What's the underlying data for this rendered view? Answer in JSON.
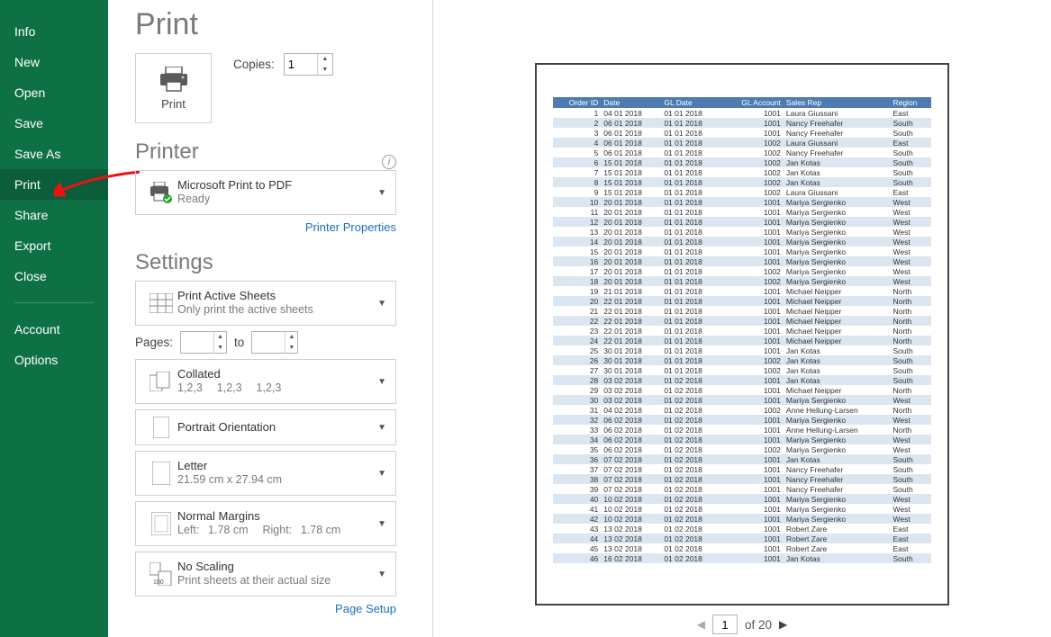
{
  "sidebar": {
    "items": [
      {
        "label": "Info"
      },
      {
        "label": "New"
      },
      {
        "label": "Open"
      },
      {
        "label": "Save"
      },
      {
        "label": "Save As"
      },
      {
        "label": "Print",
        "active": true
      },
      {
        "label": "Share"
      },
      {
        "label": "Export"
      },
      {
        "label": "Close"
      }
    ],
    "lower_items": [
      {
        "label": "Account"
      },
      {
        "label": "Options"
      }
    ]
  },
  "title": "Print",
  "print_button_label": "Print",
  "copies_label": "Copies:",
  "copies_value": "1",
  "printer_section": "Printer",
  "printer_name": "Microsoft Print to PDF",
  "printer_status": "Ready",
  "printer_properties": "Printer Properties",
  "settings_section": "Settings",
  "dd_active_sheets": {
    "title": "Print Active Sheets",
    "sub": "Only print the active sheets"
  },
  "pages_label": "Pages:",
  "pages_to": "to",
  "dd_collated": {
    "title": "Collated",
    "sub": "1,2,3  1,2,3  1,2,3"
  },
  "dd_orientation": {
    "title": "Portrait Orientation"
  },
  "dd_papersize": {
    "title": "Letter",
    "sub": "21.59 cm x 27.94 cm"
  },
  "dd_margins": {
    "title": "Normal Margins",
    "sub": "Left:  1.78 cm  Right:  1.78 cm"
  },
  "dd_scaling": {
    "title": "No Scaling",
    "sub": "Print sheets at their actual size"
  },
  "page_setup": "Page Setup",
  "pager": {
    "current": "1",
    "total": "of 20"
  },
  "preview_headers": [
    "Order ID",
    "Date",
    "GL Date",
    "GL Account",
    "Sales Rep",
    "Region"
  ],
  "preview_rows": [
    [
      "1",
      "04 01 2018",
      "01 01 2018",
      "1001",
      "Laura Giussani",
      "East"
    ],
    [
      "2",
      "06 01 2018",
      "01 01 2018",
      "1001",
      "Nancy Freehafer",
      "South"
    ],
    [
      "3",
      "06 01 2018",
      "01 01 2018",
      "1001",
      "Nancy Freehafer",
      "South"
    ],
    [
      "4",
      "06 01 2018",
      "01 01 2018",
      "1002",
      "Laura Giussani",
      "East"
    ],
    [
      "5",
      "06 01 2018",
      "01 01 2018",
      "1002",
      "Nancy Freehafer",
      "South"
    ],
    [
      "6",
      "15 01 2018",
      "01 01 2018",
      "1002",
      "Jan Kotas",
      "South"
    ],
    [
      "7",
      "15 01 2018",
      "01 01 2018",
      "1002",
      "Jan Kotas",
      "South"
    ],
    [
      "8",
      "15 01 2018",
      "01 01 2018",
      "1002",
      "Jan Kotas",
      "South"
    ],
    [
      "9",
      "15 01 2018",
      "01 01 2018",
      "1002",
      "Laura Giussani",
      "East"
    ],
    [
      "10",
      "20 01 2018",
      "01 01 2018",
      "1001",
      "Mariya Sergienko",
      "West"
    ],
    [
      "11",
      "20 01 2018",
      "01 01 2018",
      "1001",
      "Mariya Sergienko",
      "West"
    ],
    [
      "12",
      "20 01 2018",
      "01 01 2018",
      "1001",
      "Mariya Sergienko",
      "West"
    ],
    [
      "13",
      "20 01 2018",
      "01 01 2018",
      "1001",
      "Mariya Sergienko",
      "West"
    ],
    [
      "14",
      "20 01 2018",
      "01 01 2018",
      "1001",
      "Mariya Sergienko",
      "West"
    ],
    [
      "15",
      "20 01 2018",
      "01 01 2018",
      "1001",
      "Mariya Sergienko",
      "West"
    ],
    [
      "16",
      "20 01 2018",
      "01 01 2018",
      "1001",
      "Mariya Sergienko",
      "West"
    ],
    [
      "17",
      "20 01 2018",
      "01 01 2018",
      "1002",
      "Mariya Sergienko",
      "West"
    ],
    [
      "18",
      "20 01 2018",
      "01 01 2018",
      "1002",
      "Mariya Sergienko",
      "West"
    ],
    [
      "19",
      "21 01 2018",
      "01 01 2018",
      "1001",
      "Michael Neipper",
      "North"
    ],
    [
      "20",
      "22 01 2018",
      "01 01 2018",
      "1001",
      "Michael Neipper",
      "North"
    ],
    [
      "21",
      "22 01 2018",
      "01 01 2018",
      "1001",
      "Michael Neipper",
      "North"
    ],
    [
      "22",
      "22 01 2018",
      "01 01 2018",
      "1001",
      "Michael Neipper",
      "North"
    ],
    [
      "23",
      "22 01 2018",
      "01 01 2018",
      "1001",
      "Michael Neipper",
      "North"
    ],
    [
      "24",
      "22 01 2018",
      "01 01 2018",
      "1001",
      "Michael Neipper",
      "North"
    ],
    [
      "25",
      "30 01 2018",
      "01 01 2018",
      "1001",
      "Jan Kotas",
      "South"
    ],
    [
      "26",
      "30 01 2018",
      "01 01 2018",
      "1002",
      "Jan Kotas",
      "South"
    ],
    [
      "27",
      "30 01 2018",
      "01 01 2018",
      "1002",
      "Jan Kotas",
      "South"
    ],
    [
      "28",
      "03 02 2018",
      "01 02 2018",
      "1001",
      "Jan Kotas",
      "South"
    ],
    [
      "29",
      "03 02 2018",
      "01 02 2018",
      "1001",
      "Michael Neipper",
      "North"
    ],
    [
      "30",
      "03 02 2018",
      "01 02 2018",
      "1001",
      "Mariya Sergienko",
      "West"
    ],
    [
      "31",
      "04 02 2018",
      "01 02 2018",
      "1002",
      "Anne Hellung-Larsen",
      "North"
    ],
    [
      "32",
      "06 02 2018",
      "01 02 2018",
      "1001",
      "Mariya Sergienko",
      "West"
    ],
    [
      "33",
      "06 02 2018",
      "01 02 2018",
      "1001",
      "Anne Hellung-Larsen",
      "North"
    ],
    [
      "34",
      "06 02 2018",
      "01 02 2018",
      "1001",
      "Mariya Sergienko",
      "West"
    ],
    [
      "35",
      "06 02 2018",
      "01 02 2018",
      "1002",
      "Mariya Sergienko",
      "West"
    ],
    [
      "36",
      "07 02 2018",
      "01 02 2018",
      "1001",
      "Jan Kotas",
      "South"
    ],
    [
      "37",
      "07 02 2018",
      "01 02 2018",
      "1001",
      "Nancy Freehafer",
      "South"
    ],
    [
      "38",
      "07 02 2018",
      "01 02 2018",
      "1001",
      "Nancy Freehafer",
      "South"
    ],
    [
      "39",
      "07 02 2018",
      "01 02 2018",
      "1001",
      "Nancy Freehafer",
      "South"
    ],
    [
      "40",
      "10 02 2018",
      "01 02 2018",
      "1001",
      "Mariya Sergienko",
      "West"
    ],
    [
      "41",
      "10 02 2018",
      "01 02 2018",
      "1001",
      "Mariya Sergienko",
      "West"
    ],
    [
      "42",
      "10 02 2018",
      "01 02 2018",
      "1001",
      "Mariya Sergienko",
      "West"
    ],
    [
      "43",
      "13 02 2018",
      "01 02 2018",
      "1001",
      "Robert Zare",
      "East"
    ],
    [
      "44",
      "13 02 2018",
      "01 02 2018",
      "1001",
      "Robert Zare",
      "East"
    ],
    [
      "45",
      "13 02 2018",
      "01 02 2018",
      "1001",
      "Robert Zare",
      "East"
    ],
    [
      "46",
      "16 02 2018",
      "01 02 2018",
      "1001",
      "Jan Kotas",
      "South"
    ]
  ]
}
